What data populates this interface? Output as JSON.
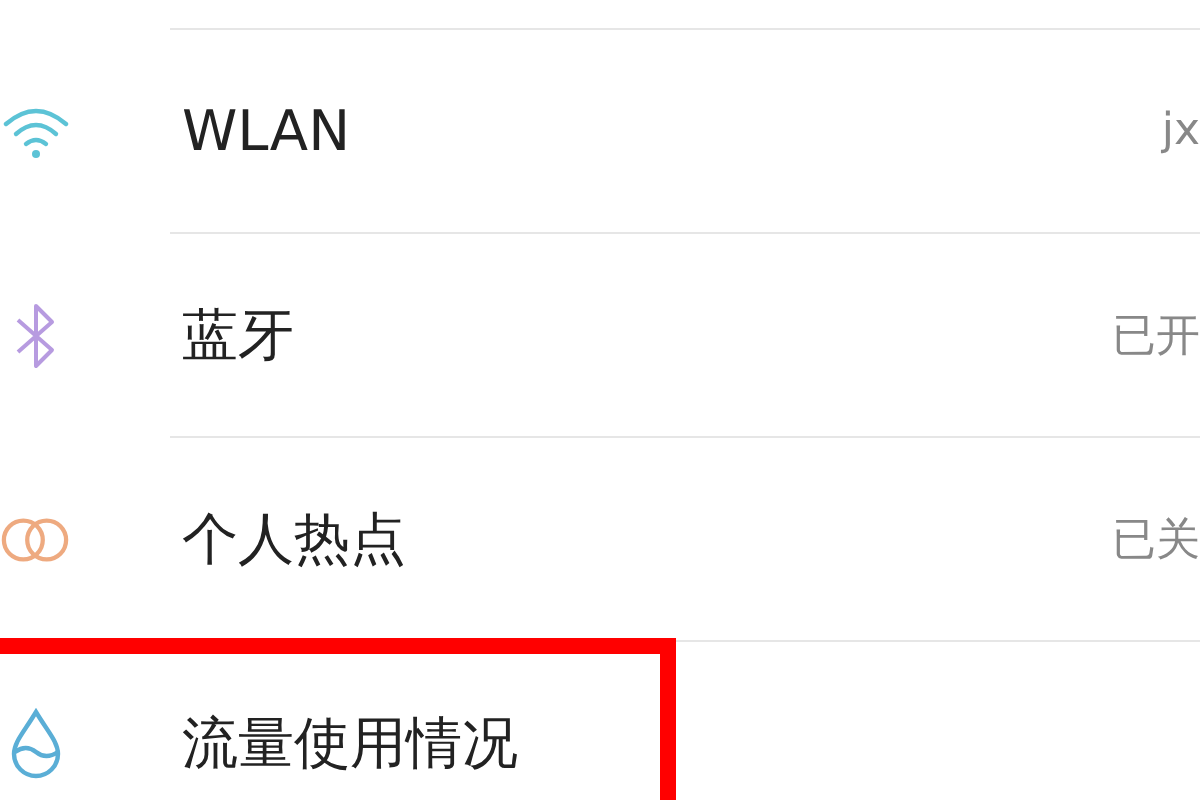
{
  "settings": [
    {
      "kind": "wifi",
      "label": "WLAN",
      "value": "jx",
      "highlighted": false
    },
    {
      "kind": "bluetooth",
      "label": "蓝牙",
      "value": "已开",
      "highlighted": false
    },
    {
      "kind": "hotspot",
      "label": "个人热点",
      "value": "已关",
      "highlighted": false
    },
    {
      "kind": "data",
      "label": "流量使用情况",
      "highlighted": true
    }
  ]
}
